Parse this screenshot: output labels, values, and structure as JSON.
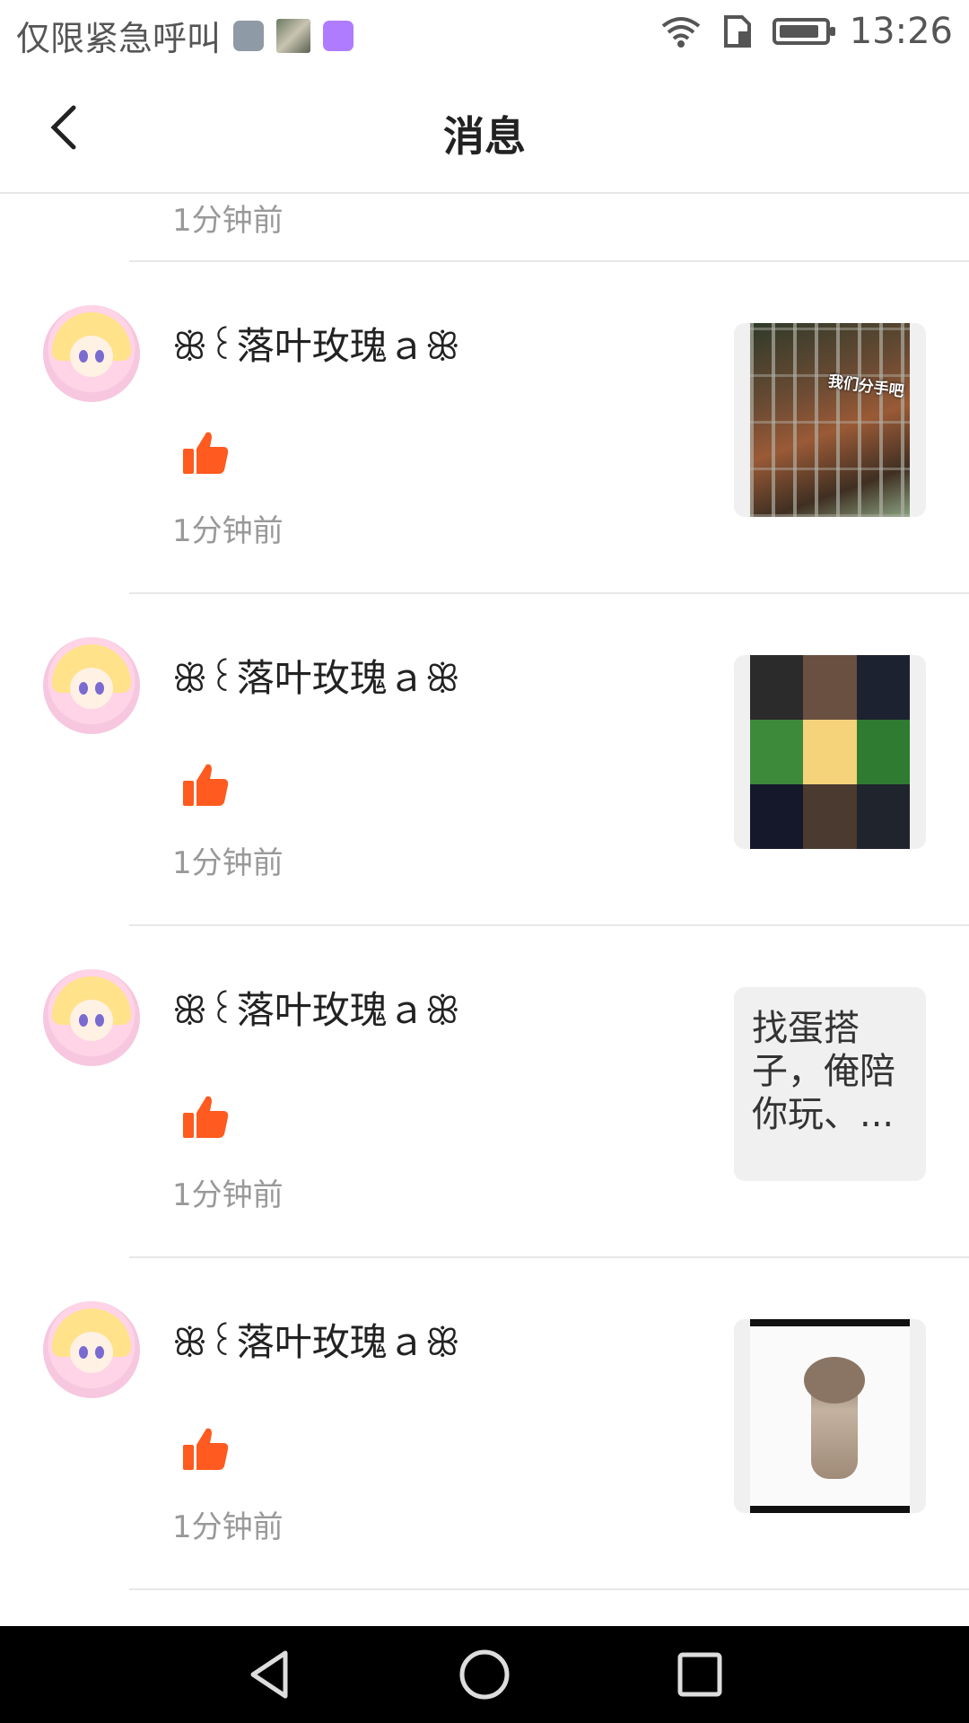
{
  "status_bar": {
    "left_text": "仅限紧急呼叫",
    "time": "13:26",
    "battery_level": 0.9,
    "icons": [
      "gallery-icon",
      "photo-thumbnail-icon",
      "keyboard-icon",
      "wifi-icon",
      "sim-icon",
      "battery-icon"
    ]
  },
  "header": {
    "title": "消息",
    "back_icon": "back-arrow-icon"
  },
  "partial_item": {
    "time": "1分钟前"
  },
  "notifications": [
    {
      "username": "ꕥ꒰落叶玫瑰ａꕥ",
      "time": "1分钟前",
      "thumb_type": "image",
      "thumb_overlay_text": "我们分手吧"
    },
    {
      "username": "ꕥ꒰落叶玫瑰ａꕥ",
      "time": "1分钟前",
      "thumb_type": "image"
    },
    {
      "username": "ꕥ꒰落叶玫瑰ａꕥ",
      "time": "1分钟前",
      "thumb_type": "text",
      "thumb_text": "找蛋搭子，俺陪你玩、..."
    },
    {
      "username": "ꕥ꒰落叶玫瑰ａꕥ",
      "time": "1分钟前",
      "thumb_type": "image"
    }
  ],
  "colors": {
    "like": "#ff5a1f",
    "secondary_text": "#999999",
    "divider": "#e8e8e8"
  },
  "nav_bar": {
    "icons": [
      "nav-back-icon",
      "nav-home-icon",
      "nav-recent-apps-icon"
    ]
  }
}
